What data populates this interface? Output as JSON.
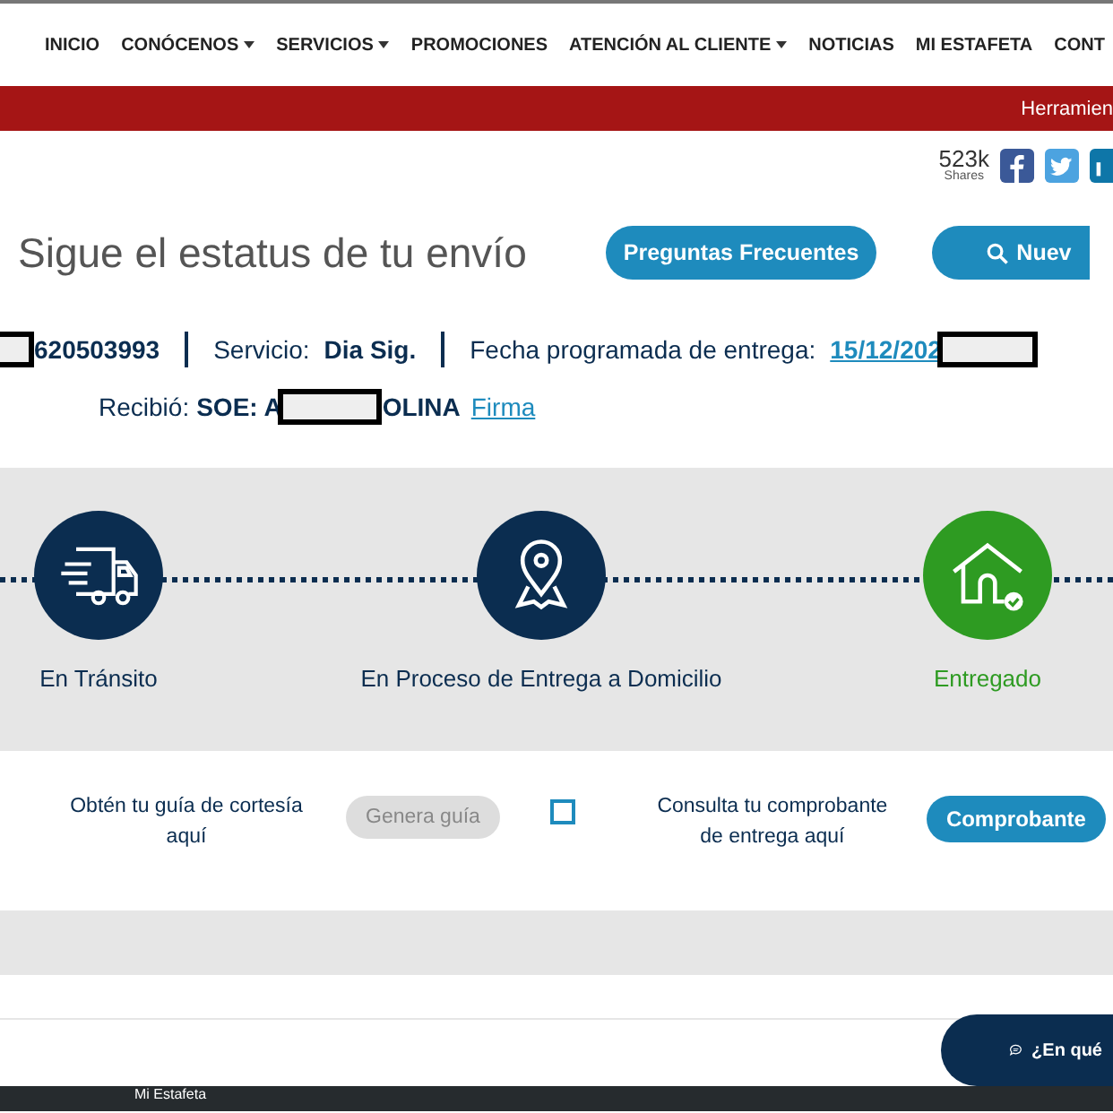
{
  "nav": {
    "items": [
      {
        "label": "INICIO",
        "dropdown": false
      },
      {
        "label": "CONÓCENOS",
        "dropdown": true
      },
      {
        "label": "SERVICIOS",
        "dropdown": true
      },
      {
        "label": "PROMOCIONES",
        "dropdown": false
      },
      {
        "label": "ATENCIÓN AL CLIENTE",
        "dropdown": true
      },
      {
        "label": "NOTICIAS",
        "dropdown": false
      },
      {
        "label": "MI ESTAFETA",
        "dropdown": false
      },
      {
        "label": "CONT",
        "dropdown": false
      }
    ]
  },
  "banner": {
    "text": "Herramien"
  },
  "shares": {
    "count": "523k",
    "label": "Shares"
  },
  "header": {
    "title": "Sigue el estatus de tu envío",
    "buttons": [
      {
        "label": "Preguntas Frecuentes"
      },
      {
        "label": "Nuev"
      }
    ]
  },
  "shipment": {
    "guide": "620503993",
    "service_label": "Servicio:",
    "service": "Dia Sig.",
    "date_label": "Fecha programada de entrega:",
    "date": "15/12/202",
    "received_label": "Recibió:",
    "received_prefix": "SOE: A",
    "received_suffix": "OLINA",
    "signature_link": "Firma"
  },
  "steps": [
    {
      "kind": "truck",
      "label": "En Tránsito",
      "current": false
    },
    {
      "kind": "pin",
      "label": "En Proceso de Entrega a Domicilio",
      "current": false
    },
    {
      "kind": "house",
      "label": "Entregado",
      "current": true
    }
  ],
  "actions": {
    "guide_text": "Obtén tu guía de cortesía aquí",
    "guide_button": {
      "label": "Genera guía",
      "disabled": true
    },
    "checkbox": {
      "checked": false
    },
    "receipt_text": "Consulta tu comprobante de entrega aquí",
    "receipt_button": "Comprobante"
  },
  "chat": {
    "label": "¿En qué"
  },
  "footer": {
    "link": "Mi Estafeta"
  }
}
